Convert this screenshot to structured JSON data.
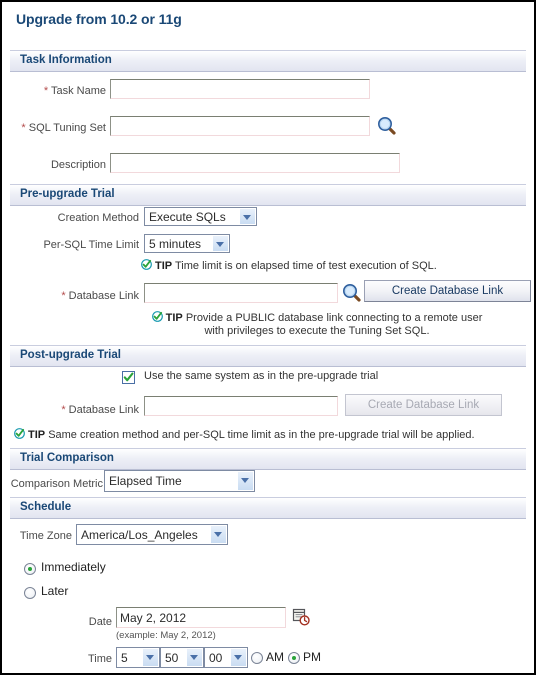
{
  "page": {
    "title": "Upgrade from 10.2 or 11g"
  },
  "sections": {
    "task_information": {
      "heading": "Task Information",
      "fields": {
        "task_name": {
          "label": "Task Name",
          "required_marker": "*",
          "value": "",
          "placeholder": ""
        },
        "sql_tuning_set": {
          "label": "SQL Tuning Set",
          "required_marker": "*",
          "value": "",
          "placeholder": "",
          "search_icon": "magnifier-icon"
        },
        "description": {
          "label": "Description",
          "required_marker": "",
          "value": "",
          "placeholder": ""
        }
      }
    },
    "pre_upgrade_trial": {
      "heading": "Pre-upgrade Trial",
      "fields": {
        "creation_method": {
          "label": "Creation Method",
          "value": "Execute SQLs",
          "options": [
            "Execute SQLs"
          ]
        },
        "per_sql_time_limit": {
          "label": "Per-SQL Time Limit",
          "value": "5 minutes",
          "options": [
            "5 minutes"
          ]
        },
        "database_link": {
          "label": "Database Link",
          "required_marker": "*",
          "value": "",
          "search_icon": "magnifier-icon",
          "button_label": "Create Database Link",
          "button_disabled": false
        }
      },
      "tips": [
        {
          "icon": "tip-check-icon",
          "prefix": "TIP",
          "text": "Time limit is on elapsed time of test execution of SQL."
        },
        {
          "icon": "tip-check-icon",
          "prefix": "TIP",
          "text": "Provide a PUBLIC database link connecting to a remote user with privileges to execute the Tuning Set SQL."
        }
      ]
    },
    "post_upgrade_trial": {
      "heading": "Post-upgrade Trial",
      "fields": {
        "use_same_system": {
          "label": "Use the same system as in the pre-upgrade trial",
          "checked": true
        },
        "database_link": {
          "label": "Database Link",
          "required_marker": "*",
          "value": "",
          "button_label": "Create Database Link",
          "button_disabled": true
        }
      },
      "tips": [
        {
          "icon": "tip-check-icon",
          "prefix": "TIP",
          "text": "Same creation method and per-SQL time limit as in the pre-upgrade trial will be applied."
        }
      ]
    },
    "trial_comparison": {
      "heading": "Trial Comparison",
      "fields": {
        "comparison_metric": {
          "label": "Comparison Metric",
          "value": "Elapsed Time",
          "options": [
            "Elapsed Time"
          ]
        }
      }
    },
    "schedule": {
      "heading": "Schedule",
      "fields": {
        "time_zone": {
          "label": "Time Zone",
          "value": "America/Los_Angeles",
          "options": [
            "America/Los_Angeles"
          ]
        },
        "immediately": {
          "label": "Immediately",
          "selected": true
        },
        "later": {
          "label": "Later",
          "selected": false
        },
        "date": {
          "label": "Date",
          "value": "May 2, 2012",
          "example": "(example: May 2, 2012)",
          "calendar_icon": "calendar-clock-icon"
        },
        "time": {
          "label": "Time",
          "hour": "5",
          "minute": "50",
          "second": "00",
          "am_label": "AM",
          "pm_label": "PM",
          "meridiem": "PM"
        }
      }
    }
  },
  "colors": {
    "title": "#1a4876",
    "section_heading": "#1a4876",
    "required_marker": "#b34b4b",
    "tip_icon": "#1a9bb0",
    "check_green": "#2aa33a",
    "band_top": "#eef0f7",
    "band_bottom": "#e2e5f0"
  }
}
